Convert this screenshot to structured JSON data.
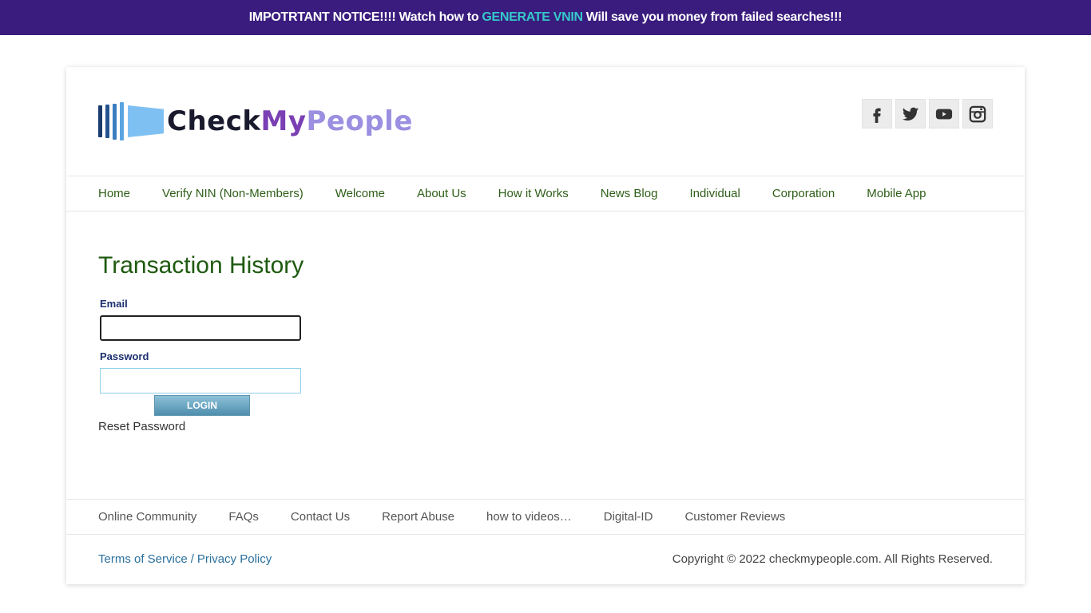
{
  "notice": {
    "prefix": "IMPOTRTANT NOTICE!!!! Watch how to",
    "highlight": "GENERATE VNIN",
    "suffix": "Will save you money from failed searches!!!",
    "highlight_color": "#35c9c9",
    "bg_color": "#3a1c7e"
  },
  "logo": {
    "part1": "Check",
    "part2": "My",
    "part3": "People"
  },
  "social": [
    "facebook-icon",
    "twitter-icon",
    "youtube-icon",
    "instagram-icon"
  ],
  "nav": {
    "items": [
      "Home",
      "Verify NIN (Non-Members)",
      "Welcome",
      "About Us",
      "How it Works",
      "News Blog",
      "Individual",
      "Corporation",
      "Mobile App"
    ]
  },
  "main": {
    "title": "Transaction History",
    "email_label": "Email",
    "email_value": "",
    "password_label": "Password",
    "password_value": "",
    "login_label": "LOGIN",
    "reset_label": "Reset Password"
  },
  "footer": {
    "links": [
      "Online Community",
      "FAQs",
      "Contact Us",
      "Report Abuse",
      "how to videos…",
      "Digital-ID",
      "Customer Reviews"
    ],
    "terms": "Terms of Service",
    "separator": "/",
    "privacy": "Privacy Policy",
    "copyright": "Copyright © 2022 checkmypeople.com. All Rights Reserved."
  }
}
